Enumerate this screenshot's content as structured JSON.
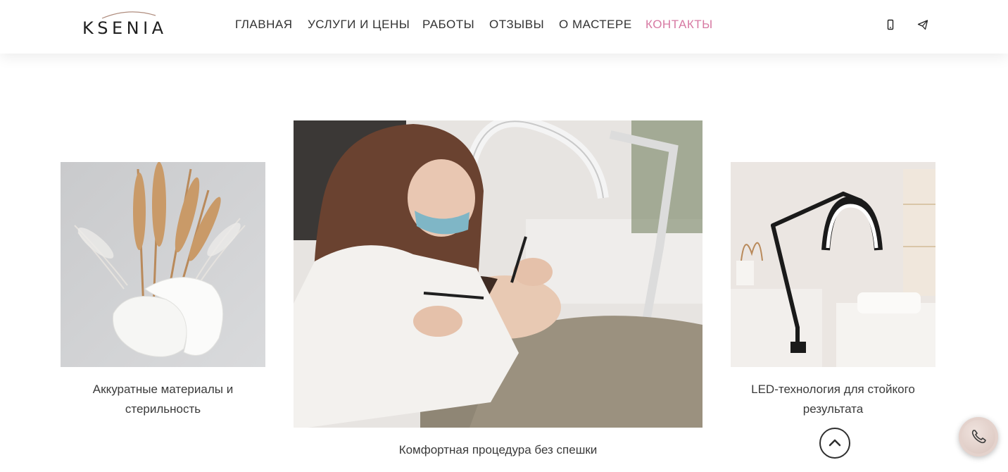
{
  "header": {
    "logo_text": "KSENIA",
    "nav": [
      {
        "label": "ГЛАВНАЯ",
        "active": false
      },
      {
        "label": "УСЛУГИ И ЦЕНЫ",
        "active": false
      },
      {
        "label": "РАБОТЫ",
        "active": false
      },
      {
        "label": "ОТЗЫВЫ",
        "active": false
      },
      {
        "label": "О МАСТЕРЕ",
        "active": false
      },
      {
        "label": "КОНТАКТЫ",
        "active": true
      }
    ],
    "icons": [
      "phone-icon",
      "telegram-icon"
    ],
    "accent_color": "#d77aa3"
  },
  "gallery": {
    "left": {
      "image": "wheat-and-eye-patches-photo",
      "caption": "Аккуратные материалы и стерильность"
    },
    "center": {
      "image": "lash-procedure-photo",
      "caption": "Комфортная процедура без спешки"
    },
    "right": {
      "image": "led-lamp-photo",
      "caption": "LED-технология для стойкого результата"
    }
  },
  "controls": {
    "scroll_top_icon": "chevron-up-icon",
    "call_icon": "phone-icon"
  }
}
